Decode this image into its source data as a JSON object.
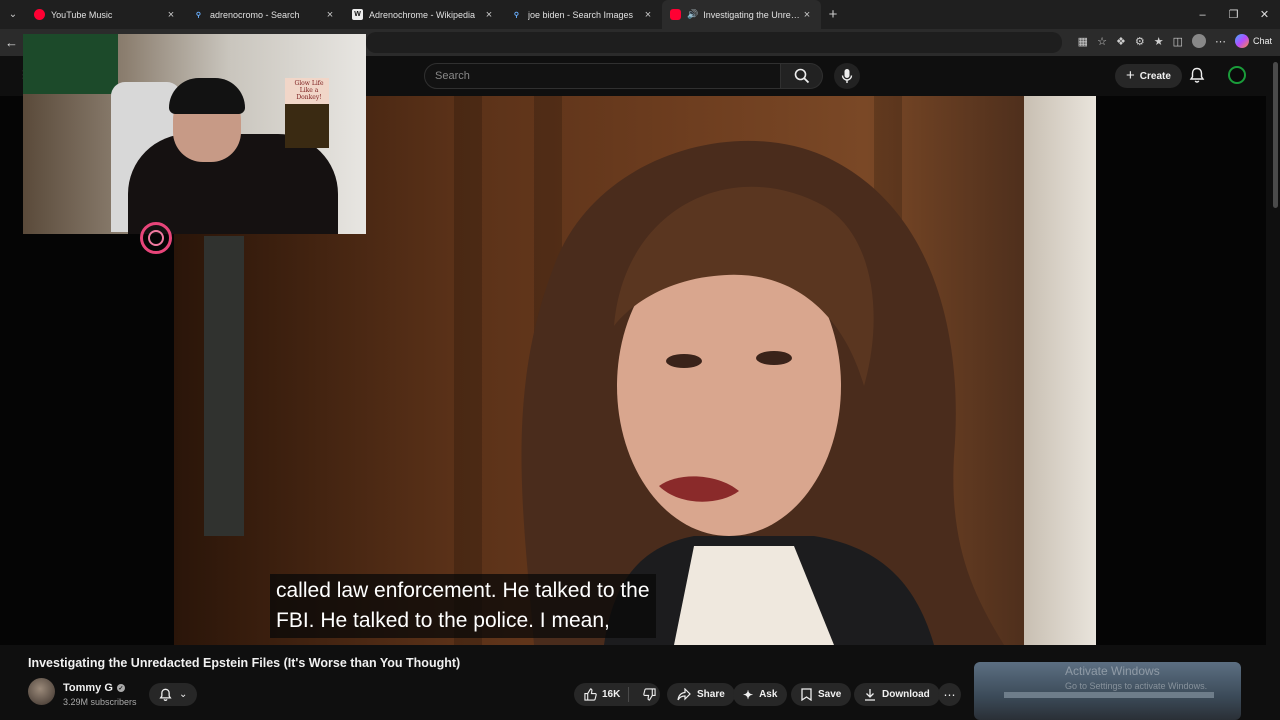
{
  "browser": {
    "tabs": [
      {
        "label": "YouTube Music",
        "favicon": "youtube-music-icon"
      },
      {
        "label": "adrenocromo - Search",
        "favicon": "search-icon"
      },
      {
        "label": "Adrenochrome - Wikipedia",
        "favicon": "wikipedia-icon"
      },
      {
        "label": "joe biden - Search Images",
        "favicon": "search-icon"
      },
      {
        "label": "Investigating the Unredacted",
        "favicon": "youtube-icon",
        "active": true
      }
    ],
    "chat_label": "Chat"
  },
  "header": {
    "search_placeholder": "Search",
    "create_label": "Create"
  },
  "player": {
    "subtitle_lines": [
      "called law enforcement. He talked to the",
      "FBI. He talked to the police. I mean,"
    ]
  },
  "webcam": {
    "poster_text": "Glow Life Like a Donkey!"
  },
  "video": {
    "title": "Investigating the Unredacted Epstein Files (It's Worse than You Thought)",
    "channel_name": "Tommy G",
    "subscribers": "3.29M subscribers",
    "likes": "16K",
    "share_label": "Share",
    "ask_label": "Ask",
    "save_label": "Save",
    "download_label": "Download"
  },
  "watermark": {
    "line1": "Activate Windows",
    "line2": "Go to Settings to activate Windows."
  },
  "colors": {
    "background": "#0f0f0f",
    "pill": "#272727",
    "youtube_red": "#ff0033"
  }
}
